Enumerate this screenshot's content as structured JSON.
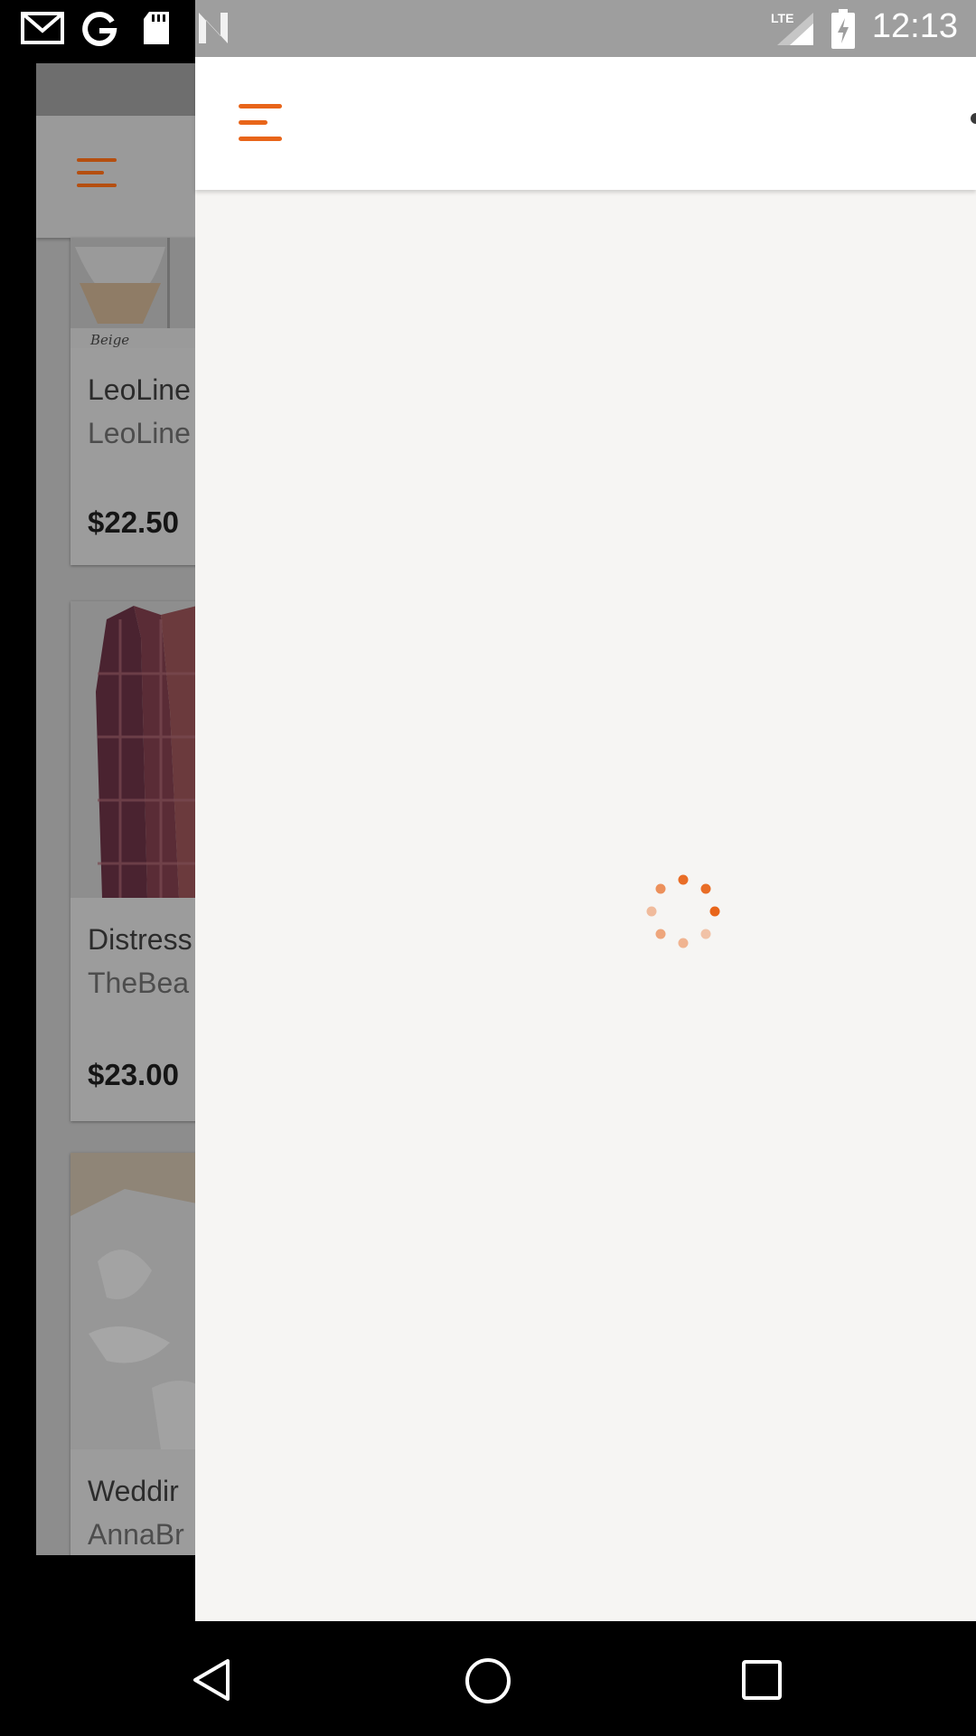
{
  "status_bar": {
    "time": "12:13",
    "icons": [
      "gmail-icon",
      "google-icon",
      "sd-card-icon",
      "n-icon",
      "lte-signal-icon",
      "battery-charging-icon"
    ],
    "network": "LTE"
  },
  "background_screen": {
    "cards": [
      {
        "thumb_label": "Beige",
        "title": "LeoLine",
        "shop": "LeoLine",
        "price": "$22.50"
      },
      {
        "title": "Distress",
        "shop": "TheBea",
        "price": "$23.00"
      },
      {
        "title": "Weddir",
        "shop": "AnnaBr"
      }
    ]
  },
  "panel": {
    "state": "loading"
  },
  "colors": {
    "accent": "#e8651a",
    "panel_bg": "#f6f5f3",
    "header_bg": "#ffffff"
  },
  "nav_bar": {
    "buttons": [
      "back-icon",
      "home-icon",
      "recents-icon"
    ]
  }
}
